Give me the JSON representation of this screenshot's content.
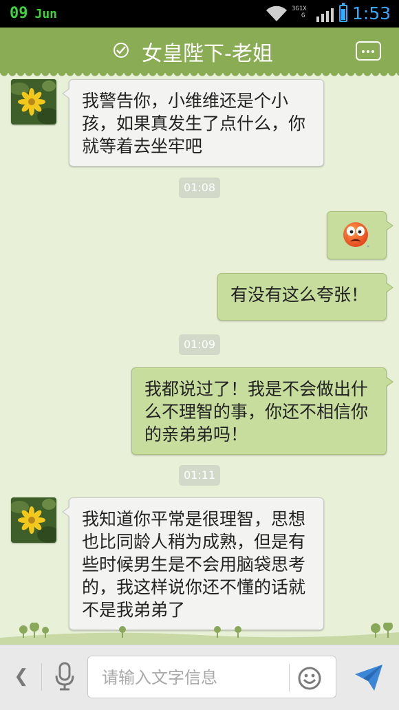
{
  "status_bar": {
    "day": "09",
    "month": "Jun",
    "network_top": "3G",
    "network_mid": "1X",
    "network_g": "G",
    "time": "1:53",
    "icons": [
      "wifi-icon",
      "signal-icon",
      "battery-icon"
    ]
  },
  "header": {
    "title": "女皇陛下-老姐",
    "verified_icon": "check-circle-icon",
    "menu_icon": "more-icon"
  },
  "messages": [
    {
      "side": "left",
      "text": "我警告你，小维维还是个小孩，如果真发生了点什么，你就等着去坐牢吧"
    },
    {
      "type": "time",
      "text": "01:08"
    },
    {
      "side": "right",
      "emoji": "shocked-face-icon"
    },
    {
      "side": "right",
      "text": "有没有这么夸张！"
    },
    {
      "type": "time",
      "text": "01:09"
    },
    {
      "side": "right",
      "text": "我都说过了！我是不会做出什么不理智的事，你还不相信你的亲弟弟吗！"
    },
    {
      "type": "time",
      "text": "01:11"
    },
    {
      "side": "left",
      "text": "我知道你平常是很理智，思想也比同龄人稍为成熟，但是有些时候男生是不会用脑袋思考的，我这样说你还不懂的话就不是我弟弟了"
    }
  ],
  "input_bar": {
    "placeholder": "请输入文字信息",
    "icons": [
      "back-icon",
      "microphone-icon",
      "emoji-icon",
      "send-icon"
    ]
  },
  "colors": {
    "header": "#8aac54",
    "background": "#e8f0d8",
    "sent_bubble": "#c7dd9d",
    "received_bubble": "#f3f4f1",
    "time_accent": "#33aaff",
    "date_accent": "#3fd13f"
  }
}
